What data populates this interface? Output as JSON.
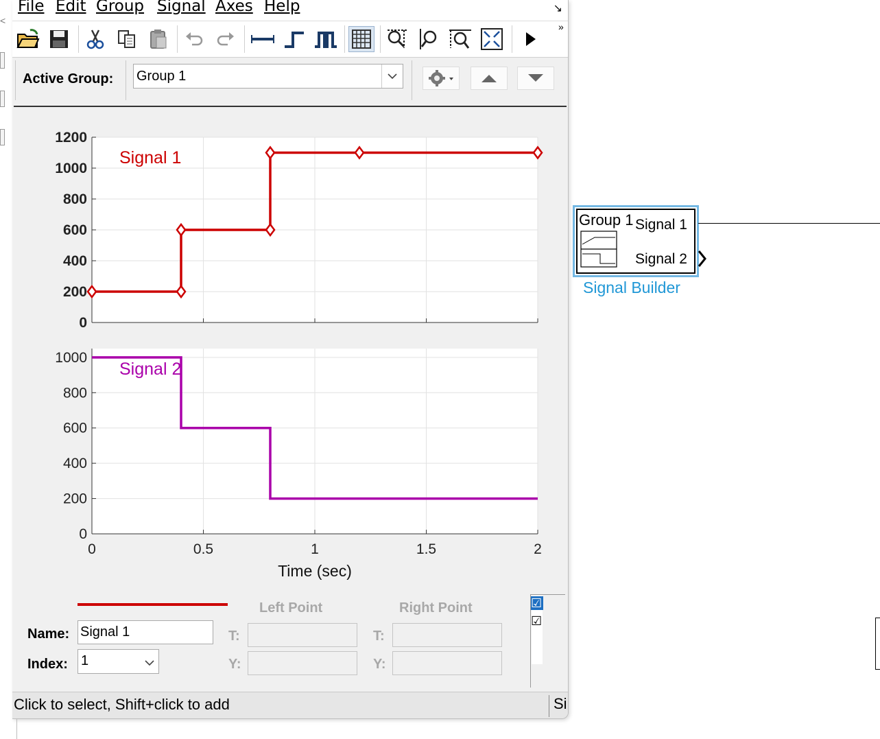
{
  "menu": [
    {
      "label": "File"
    },
    {
      "label": "Edit"
    },
    {
      "label": "Group"
    },
    {
      "label": "Signal"
    },
    {
      "label": "Axes"
    },
    {
      "label": "Help"
    }
  ],
  "menu_corner": "↘",
  "toolbar": {
    "overflow": "»",
    "icons": [
      "open-folder-icon",
      "save-icon",
      "cut-icon",
      "copy-icon",
      "paste-icon",
      "undo-icon",
      "redo-icon",
      "constant-signal-icon",
      "step-signal-icon",
      "pulse-signal-icon",
      "grid-icon",
      "zoom-xy-icon",
      "zoom-y-icon",
      "zoom-x-icon",
      "zoom-fit-icon",
      "run-icon"
    ]
  },
  "active_group": {
    "label": "Active Group:",
    "value": "Group 1"
  },
  "chart_data": [
    {
      "type": "line",
      "series": [
        {
          "name": "Signal 1",
          "color": "#cc0000",
          "x": [
            0,
            0.4,
            0.4,
            0.8,
            0.8,
            1.2,
            2
          ],
          "y": [
            200,
            200,
            600,
            600,
            1100,
            1100,
            1100
          ]
        }
      ],
      "xlim": [
        0,
        2
      ],
      "ylim": [
        0,
        1200
      ],
      "yticks": [
        "0",
        "200",
        "400",
        "600",
        "800",
        "1000",
        "1200"
      ],
      "grid": true,
      "selected": true
    },
    {
      "type": "line",
      "series": [
        {
          "name": "Signal 2",
          "color": "#aa00aa",
          "x": [
            0,
            0.4,
            0.4,
            0.8,
            0.8,
            2
          ],
          "y": [
            1000,
            1000,
            600,
            600,
            200,
            200
          ]
        }
      ],
      "xlim": [
        0,
        2
      ],
      "ylim": [
        0,
        1050
      ],
      "yticks": [
        "0",
        "200",
        "400",
        "600",
        "800",
        "1000"
      ],
      "xticks": [
        "0",
        "0.5",
        "1",
        "1.5",
        "2"
      ],
      "xlabel": "Time (sec)",
      "grid": true
    }
  ],
  "signal_panel": {
    "line_color": "#cc0000",
    "name_label": "Name:",
    "name_value": "Signal 1",
    "index_label": "Index:",
    "index_value": "1",
    "left_point": "Left Point",
    "right_point": "Right Point",
    "t_label": "T:",
    "y_label": "Y:",
    "check_1": "☑",
    "check_2": "☑"
  },
  "status": {
    "text": "Click to select, Shift+click to add",
    "right": "Si"
  },
  "block": {
    "group": "Group 1",
    "signal_1": "Signal 1",
    "signal_2": "Signal 2",
    "caption": "Signal Builder"
  }
}
